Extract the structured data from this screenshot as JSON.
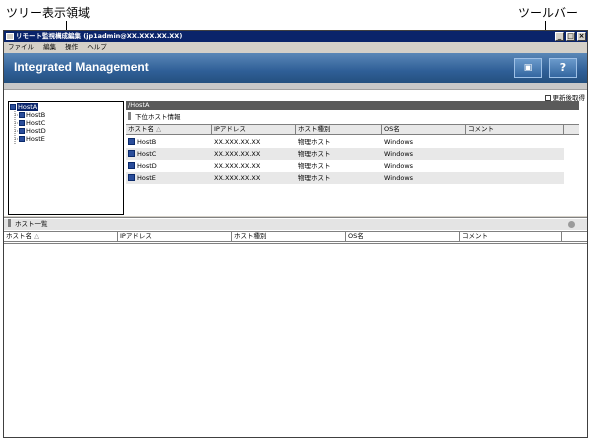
{
  "callouts": {
    "tree_area": "ツリー表示領域",
    "toolbar": "ツールバー"
  },
  "window": {
    "title": "リモート監視構成編集 (jp1admin@XX.XXX.XX.XX)",
    "minimize": "_",
    "maximize": "□",
    "close": "×"
  },
  "menu": [
    "ファイル",
    "編集",
    "操作",
    "ヘルプ"
  ],
  "banner": {
    "title": "Integrated Management",
    "toolbar_button_1": "▣",
    "toolbar_button_2": "?"
  },
  "refresh_label": "更新後取得",
  "tree": {
    "root": "HostA",
    "children": [
      "HostB",
      "HostC",
      "HostD",
      "HostE"
    ]
  },
  "detail": {
    "path": "/HostA",
    "section_title": "下位ホスト情報",
    "columns": [
      "ホスト名",
      "IPアドレス",
      "ホスト種別",
      "OS名",
      "コメント"
    ],
    "sort_mark": "△",
    "rows": [
      {
        "host": "HostB",
        "ip": "XX.XXX.XX.XX",
        "type": "物理ホスト",
        "os": "Windows",
        "comment": ""
      },
      {
        "host": "HostC",
        "ip": "XX.XXX.XX.XX",
        "type": "物理ホスト",
        "os": "Windows",
        "comment": ""
      },
      {
        "host": "HostD",
        "ip": "XX.XXX.XX.XX",
        "type": "物理ホスト",
        "os": "Windows",
        "comment": ""
      },
      {
        "host": "HostE",
        "ip": "XX.XXX.XX.XX",
        "type": "物理ホスト",
        "os": "Windows",
        "comment": ""
      }
    ]
  },
  "host_list": {
    "title": "ホスト一覧",
    "columns": [
      "ホスト名",
      "IPアドレス",
      "ホスト種別",
      "OS名",
      "コメント"
    ],
    "sort_mark": "△"
  },
  "colors": {
    "titlebar": "#0a246a",
    "banner": "#2f5f97",
    "selected": "#0a246a"
  }
}
